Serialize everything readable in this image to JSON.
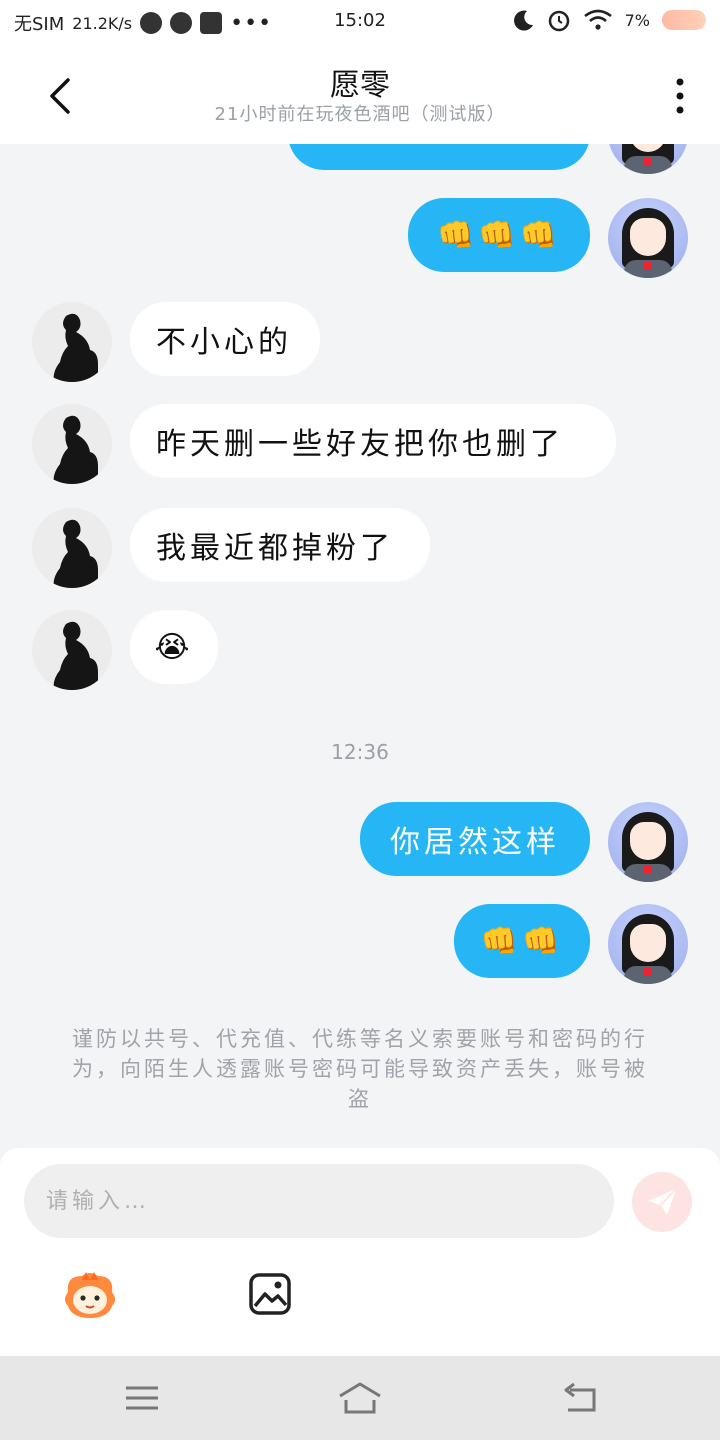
{
  "status_bar": {
    "carrier": "无SIM",
    "speed": "21.2K/s",
    "time": "15:02",
    "battery": "7%",
    "icons": [
      "planet-icon",
      "palette-icon",
      "database-icon",
      "more-dots-icon",
      "moon-icon",
      "alarm-icon",
      "wifi-icon",
      "battery-icon"
    ]
  },
  "header": {
    "title": "愿零",
    "subtitle": "21小时前在玩夜色酒吧（测试版）",
    "back_icon": "chevron-left-icon",
    "more_icon": "vertical-dots-icon"
  },
  "messages": [
    {
      "side": "out",
      "text": "",
      "partial": true
    },
    {
      "side": "out",
      "text": "👊👊👊"
    },
    {
      "side": "in",
      "text": "不小心的"
    },
    {
      "side": "in",
      "text": "昨天删一些好友把你也删了"
    },
    {
      "side": "in",
      "text": "我最近都掉粉了"
    },
    {
      "side": "in",
      "text": "😭"
    },
    {
      "side": "out",
      "text": "你居然这样"
    },
    {
      "side": "out",
      "text": "👊👊"
    }
  ],
  "timestamp": "12:36",
  "notice": "谨防以共号、代充值、代练等名义索要账号和密码的行为，向陌生人透露账号密码可能导致资产丢失，账号被盗",
  "input": {
    "placeholder": "请输入…",
    "value": ""
  },
  "toolbar": {
    "mascot_icon": "mascot-sticker-icon",
    "image_icon": "image-icon",
    "send_icon": "paper-plane-icon"
  },
  "navbar": {
    "icons": [
      "menu-icon",
      "home-icon",
      "back-icon"
    ]
  },
  "colors": {
    "outgoing_bubble": "#27b6f5",
    "incoming_bubble": "#ffffff",
    "background": "#f3f4f6",
    "send_button": "#fde4e2"
  }
}
